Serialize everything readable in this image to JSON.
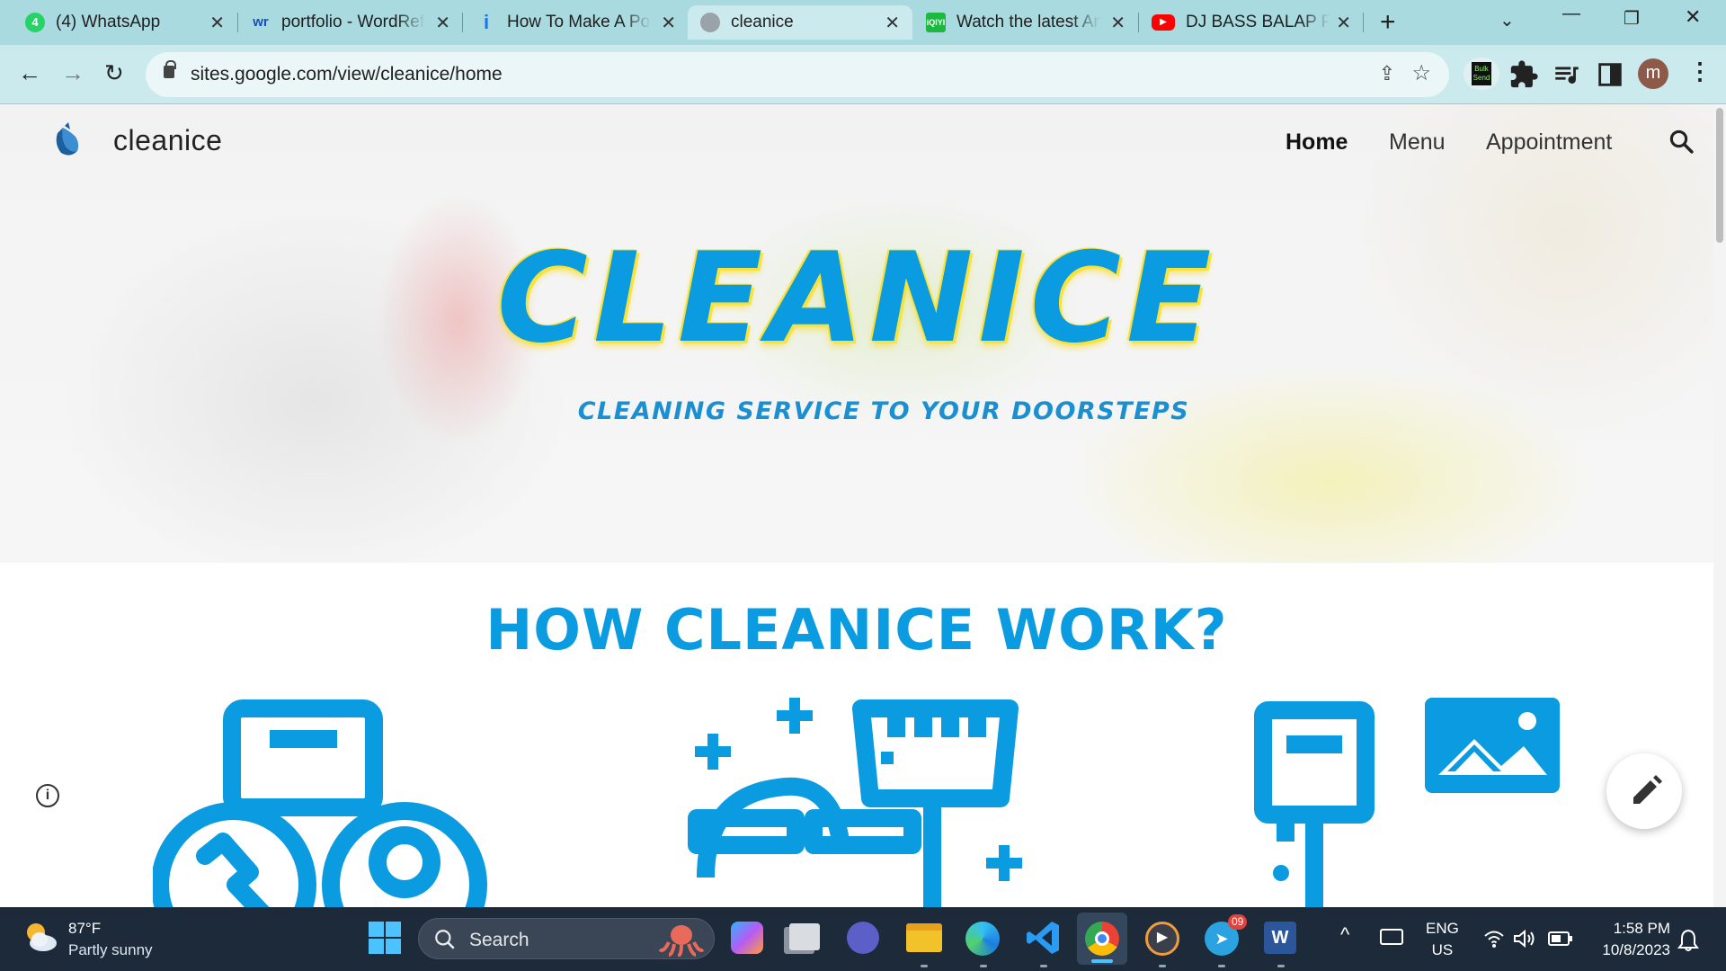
{
  "browser": {
    "tabs": [
      {
        "title": "(4) WhatsApp",
        "icon": "whatsapp-icon",
        "active": false
      },
      {
        "title": "portfolio - WordReference",
        "icon": "wordreference-icon",
        "active": false
      },
      {
        "title": "How To Make A Portfolio",
        "icon": "info-icon",
        "active": false
      },
      {
        "title": "cleanice",
        "icon": "globe-icon",
        "active": true
      },
      {
        "title": "Watch the latest Anime",
        "icon": "iqiyi-icon",
        "active": false
      },
      {
        "title": "DJ BASS BALAP PALING",
        "icon": "youtube-icon",
        "active": false
      }
    ],
    "url": "sites.google.com/view/cleanice/home",
    "profile_initial": "m",
    "ext_label": "Bulk Send"
  },
  "site": {
    "name": "cleanice",
    "nav": [
      {
        "label": "Home",
        "active": true
      },
      {
        "label": "Menu",
        "active": false
      },
      {
        "label": "Appointment",
        "active": false
      }
    ],
    "hero_title": "CLEANICE",
    "hero_subtitle": "CLEANING SERVICE TO YOUR DOORSTEPS",
    "section_title": "HOW CLEANICE WORK?",
    "accent": "#0a9be0",
    "yellow": "#f6e13a",
    "steps": [
      {
        "icon": "phone-contact-icon"
      },
      {
        "icon": "cleaning-icon"
      },
      {
        "icon": "board-gallery-icon"
      }
    ]
  },
  "taskbar": {
    "temp": "87°F",
    "weather": "Partly sunny",
    "search_label": "Search",
    "lang1": "ENG",
    "lang2": "US",
    "time": "1:58 PM",
    "date": "10/8/2023",
    "telegram_badge": "09"
  }
}
